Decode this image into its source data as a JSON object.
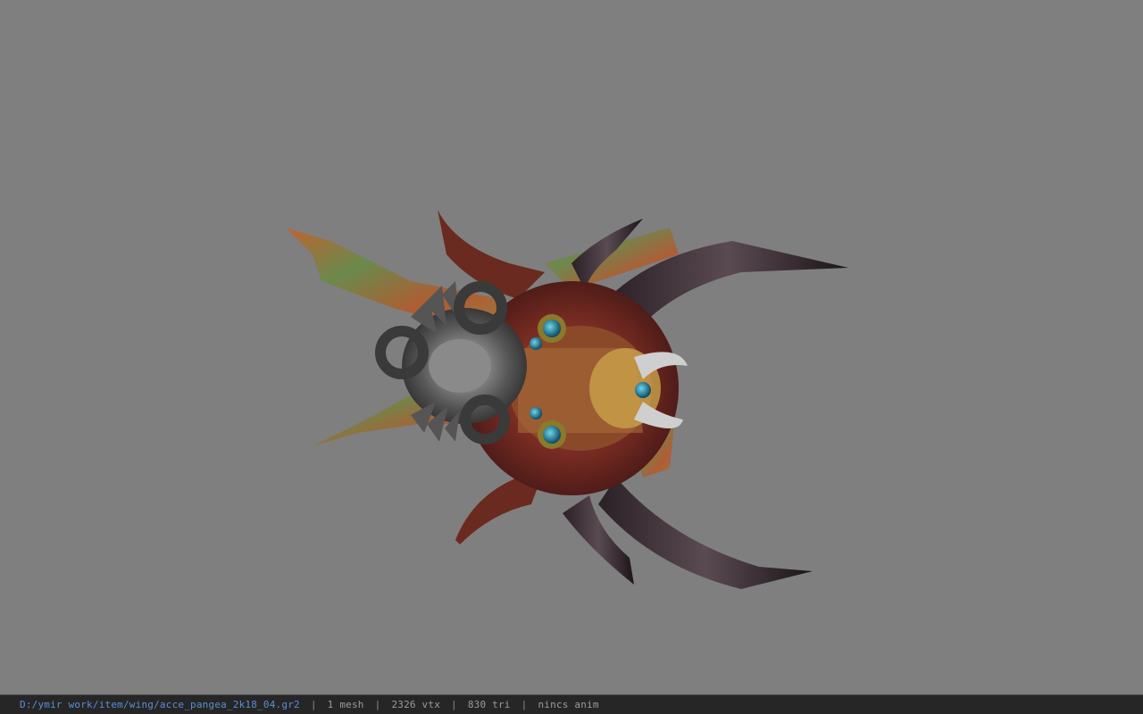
{
  "viewport": {
    "background_color": "#7f7f7f",
    "model_name": "wing-accessory-model"
  },
  "statusbar": {
    "file_path": "D:/ymir work/item/wing/acce_pangea_2k18_04.gr2",
    "mesh_count": "1 mesh",
    "vertex_count": "2326 vtx",
    "triangle_count": "830 tri",
    "anim_status": "nincs anim",
    "separator": "|",
    "path_color": "#5b8fd0"
  }
}
